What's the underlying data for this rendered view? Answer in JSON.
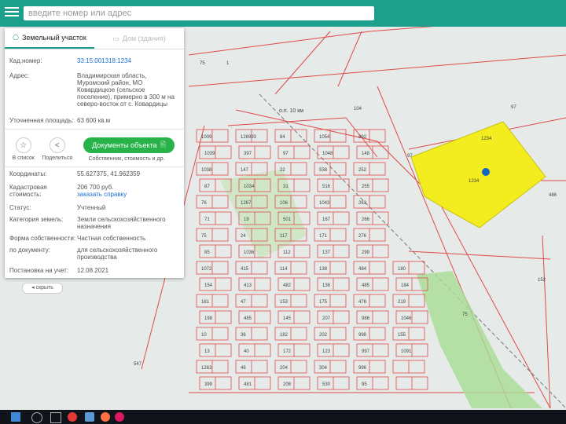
{
  "search": {
    "placeholder": "введите номер или адрес"
  },
  "card": {
    "tab_active": "Земельный участок",
    "tab_inactive": "Дом (здания)",
    "cad_label": "Кад.номер:",
    "cad_value": "33:15:001318:1234",
    "address_label": "Адрес:",
    "address_value": "Владимирская область, Муромский район, МО Ковардицкое (сельское поселение), примерно в 300 м на северо-восток от с. Ковардицы",
    "area_label": "Уточненная площадь:",
    "area_value": "63 600 кв.м",
    "btn_list": "В список",
    "btn_share": "Поделиться",
    "doc_button": "Документы объекта",
    "doc_sub": "Собственник, стоимость и др.",
    "coords_label": "Координаты:",
    "coords_value": "55.627375, 41.962359",
    "cost_label": "Кадастровая стоимость:",
    "cost_value": "206 700 руб.",
    "cost_link": "заказать справку",
    "status_label": "Статус:",
    "status_value": "Учтенный",
    "category_label": "Категория земель:",
    "category_value": "Земли сельскохозяйственного назначения",
    "ownership_label": "Форма собственности:",
    "ownership_value": "Частная собственность",
    "use_label": "по документу:",
    "use_value": "для сельскохозяйственного производства",
    "reg_label": "Постановка на учет:",
    "reg_value": "12.08.2021"
  },
  "collapse_label": "скрыть",
  "map": {
    "road_label": "о.п. 10 км",
    "parcel_labels": [
      "1234",
      "1234",
      "75",
      "1",
      "97",
      "97",
      "486",
      "152",
      "75",
      "547",
      "104"
    ],
    "block_labels": [
      "1009",
      "1039",
      "1038",
      "87",
      "76",
      "71",
      "75",
      "85",
      "1072",
      "154",
      "161",
      "198",
      "10",
      "13",
      "1263",
      "399",
      "126993",
      "397",
      "147",
      "1034",
      "1267",
      "19",
      "24",
      "1036",
      "415",
      "413",
      "47",
      "465",
      "36",
      "40",
      "46",
      "481",
      "84",
      "97",
      "22",
      "31",
      "106",
      "501",
      "117",
      "112",
      "114",
      "482",
      "153",
      "145",
      "182",
      "172",
      "204",
      "208",
      "1054",
      "1048",
      "538",
      "516",
      "1043",
      "167",
      "171",
      "137",
      "138",
      "136",
      "175",
      "207",
      "202",
      "123",
      "304",
      "530",
      "892",
      "148",
      "252",
      "255",
      "263",
      "266",
      "276",
      "299",
      "484",
      "485",
      "476",
      "986",
      "998",
      "997",
      "996",
      "95",
      "180",
      "184",
      "219",
      "1046",
      "155",
      "1091"
    ]
  },
  "colors": {
    "header": "#1c9f8b",
    "selected_parcel": "#f3ec1f",
    "boundary": "#e04a4a",
    "doc_button": "#27b34a",
    "marker": "#1565c0"
  }
}
